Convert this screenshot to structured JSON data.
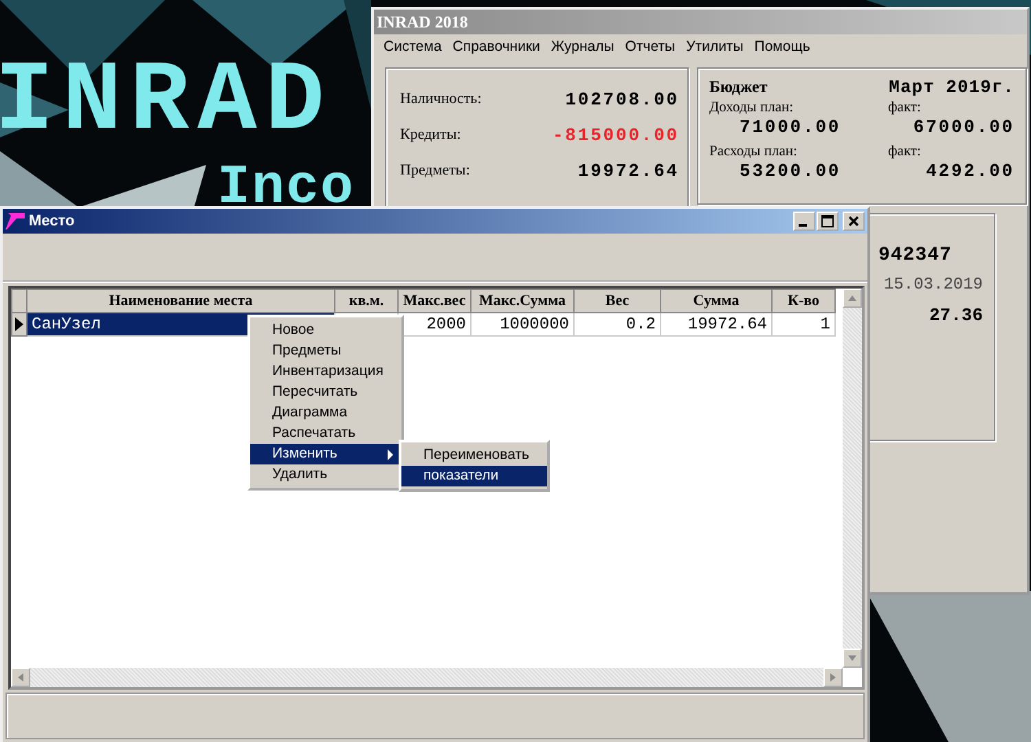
{
  "desktop": {
    "logo_lines": [
      "INRAD",
      "Inco"
    ]
  },
  "main_window": {
    "title": "INRAD 2018",
    "menu": [
      "Система",
      "Справочники",
      "Журналы",
      "Отчеты",
      "Утилиты",
      "Помощь"
    ],
    "balance": [
      {
        "label": "Наличность:",
        "value": "102708.00",
        "negative": false
      },
      {
        "label": "Кредиты:",
        "value": "-815000.00",
        "negative": true
      },
      {
        "label": "Предметы:",
        "value": "19972.64",
        "negative": false
      }
    ],
    "budget": {
      "title": "Бюджет",
      "period": "Март 2019г.",
      "rows": [
        {
          "plan_label": "Доходы план:",
          "plan_value": "71000.00",
          "fact_label": "факт:",
          "fact_value": "67000.00"
        },
        {
          "plan_label": "Расходы план:",
          "plan_value": "53200.00",
          "fact_label": "факт:",
          "fact_value": "4292.00"
        }
      ]
    },
    "summary": [
      {
        "text": "942347",
        "kind": "number"
      },
      {
        "text": "15.03.2019",
        "kind": "date"
      },
      {
        "text": "27.36",
        "kind": "amount"
      }
    ]
  },
  "place_window": {
    "title": "Место",
    "table": {
      "columns": [
        "Наименование места",
        "кв.м.",
        "Макс.вес",
        "Макс.Сумма",
        "Вес",
        "Сумма",
        "К-во"
      ],
      "rows": [
        {
          "selected": true,
          "cells": [
            "СанУзел",
            null,
            "2000",
            "1000000",
            "0.2",
            "19972.64",
            "1"
          ]
        }
      ]
    },
    "context_menu": {
      "items": [
        {
          "label": "Новое",
          "selected": false,
          "submenu": false
        },
        {
          "label": "Предметы",
          "selected": false,
          "submenu": false
        },
        {
          "label": "Инвентаризация",
          "selected": false,
          "submenu": false
        },
        {
          "label": "Пересчитать",
          "selected": false,
          "submenu": false
        },
        {
          "label": "Диаграмма",
          "selected": false,
          "submenu": false
        },
        {
          "label": "Распечатать",
          "selected": false,
          "submenu": false
        },
        {
          "label": "Изменить",
          "selected": true,
          "submenu": true
        },
        {
          "label": "Удалить",
          "selected": false,
          "submenu": false
        }
      ],
      "submenu": [
        {
          "label": "Переименовать",
          "selected": false
        },
        {
          "label": "показатели",
          "selected": true
        }
      ]
    }
  }
}
